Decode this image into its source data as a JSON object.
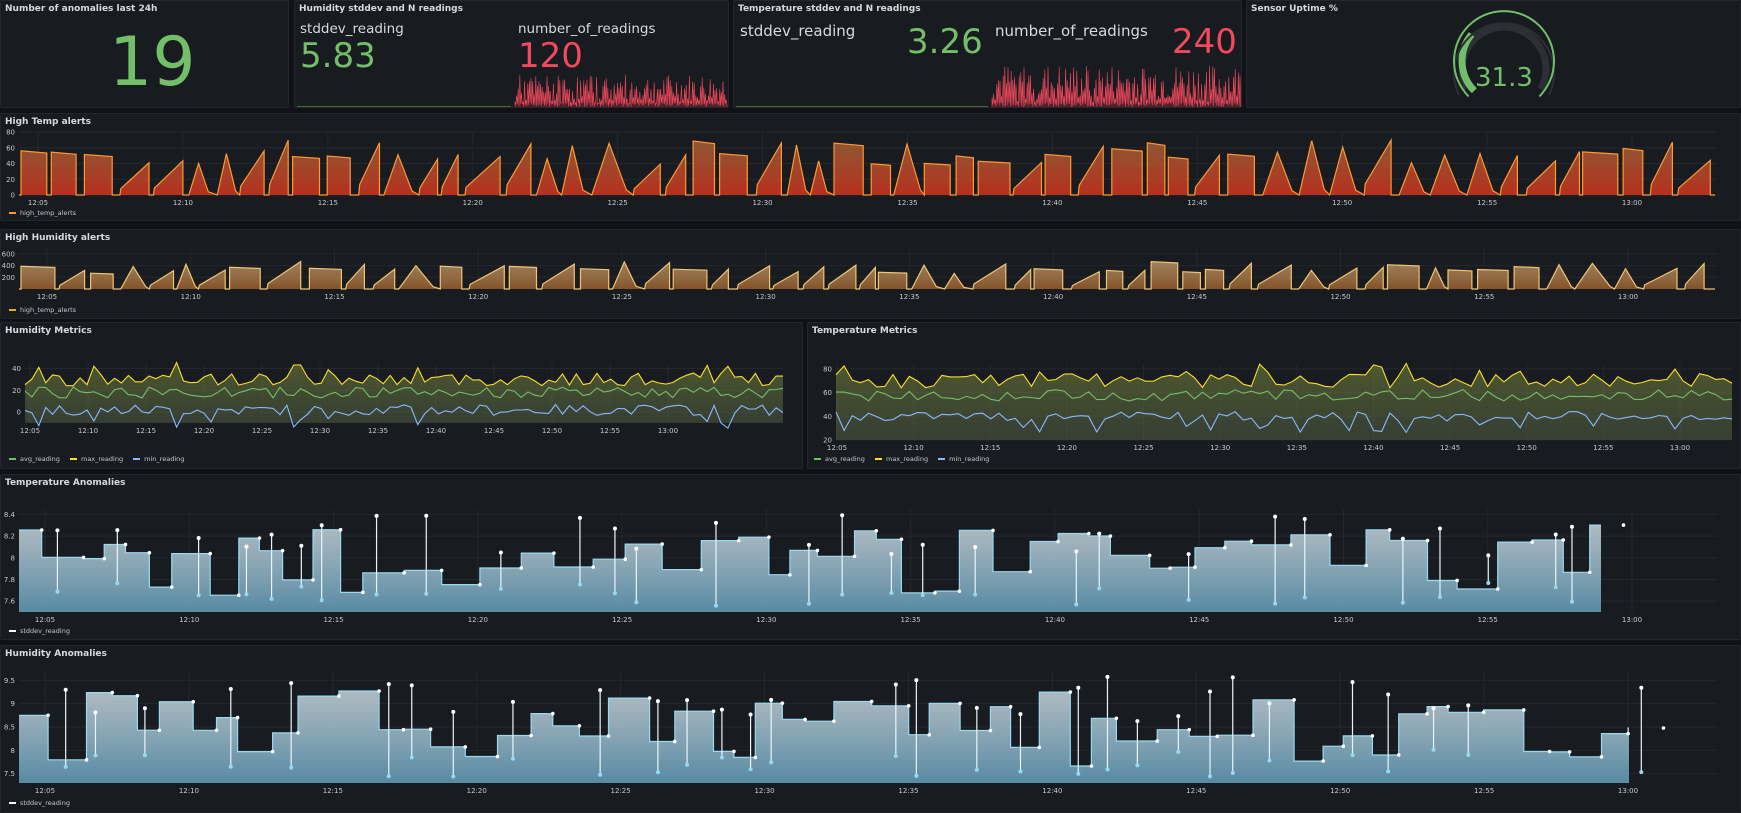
{
  "panels": {
    "anomalies": {
      "title": "Number of anomalies last 24h",
      "value": "19"
    },
    "humidity_stats": {
      "title": "Humidity stddev and N readings",
      "stddev_label": "stddev_reading",
      "stddev_value": "5.83",
      "count_label": "number_of_readings",
      "count_value": "120"
    },
    "temp_stats": {
      "title": "Temperature stddev and N readings",
      "stddev_label": "stddev_reading",
      "stddev_value": "3.26",
      "count_label": "number_of_readings",
      "count_value": "240"
    },
    "uptime": {
      "title": "Sensor Uptime %",
      "value": "31.3",
      "gauge_fraction": 0.313
    },
    "high_temp": {
      "title": "High Temp alerts",
      "legend": "high_temp_alerts"
    },
    "high_humidity": {
      "title": "High Humidity alerts",
      "legend": "high_temp_alerts"
    },
    "humidity_metrics": {
      "title": "Humidity Metrics",
      "legend": [
        "avg_reading",
        "max_reading",
        "min_reading"
      ]
    },
    "temp_metrics": {
      "title": "Temperature Metrics",
      "legend": [
        "avg_reading",
        "max_reading",
        "min_reading"
      ]
    },
    "temp_anomalies": {
      "title": "Temperature Anomalies",
      "legend": "stddev_reading"
    },
    "humidity_anomalies": {
      "title": "Humidity Anomalies",
      "legend": "stddev_reading"
    }
  },
  "colors": {
    "green": "#73bf69",
    "red": "#f2495c",
    "orange": "#ff9830",
    "yellow": "#fade2a",
    "blue": "#8ab8ff",
    "cyan": "#96d9f0"
  },
  "chart_data": [
    {
      "id": "high_temp",
      "type": "area",
      "title": "High Temp alerts",
      "x": [
        "12:05",
        "12:10",
        "12:15",
        "12:20",
        "12:25",
        "12:30",
        "12:35",
        "12:40",
        "12:45",
        "12:50",
        "12:55",
        "13:00"
      ],
      "yticks": [
        0,
        20,
        40,
        60,
        80
      ],
      "ylim": [
        0,
        80
      ],
      "series": [
        {
          "name": "high_temp_alerts",
          "color": "#ff9830"
        }
      ]
    },
    {
      "id": "high_humidity",
      "type": "area",
      "title": "High Humidity alerts",
      "x": [
        "12:05",
        "12:10",
        "12:15",
        "12:20",
        "12:25",
        "12:30",
        "12:35",
        "12:40",
        "12:45",
        "12:50",
        "12:55",
        "13:00"
      ],
      "yticks": [
        200,
        400,
        600
      ],
      "ylim": [
        0,
        700
      ],
      "series": [
        {
          "name": "high_temp_alerts",
          "color": "#e0b400"
        }
      ]
    },
    {
      "id": "humidity_metrics",
      "type": "line",
      "title": "Humidity Metrics",
      "x": [
        "12:05",
        "12:10",
        "12:15",
        "12:20",
        "12:25",
        "12:30",
        "12:35",
        "12:40",
        "12:45",
        "12:50",
        "12:55",
        "13:00"
      ],
      "yticks": [
        0,
        20,
        40
      ],
      "ylim": [
        -10,
        45
      ],
      "series": [
        {
          "name": "avg_reading",
          "color": "#73bf69"
        },
        {
          "name": "max_reading",
          "color": "#fade2a"
        },
        {
          "name": "min_reading",
          "color": "#8ab8ff"
        }
      ]
    },
    {
      "id": "temp_metrics",
      "type": "line",
      "title": "Temperature Metrics",
      "x": [
        "12:05",
        "12:10",
        "12:15",
        "12:20",
        "12:25",
        "12:30",
        "12:35",
        "12:40",
        "12:45",
        "12:50",
        "12:55",
        "13:00"
      ],
      "yticks": [
        20,
        40,
        60,
        80
      ],
      "ylim": [
        20,
        85
      ],
      "series": [
        {
          "name": "avg_reading",
          "color": "#73bf69"
        },
        {
          "name": "max_reading",
          "color": "#fade2a"
        },
        {
          "name": "min_reading",
          "color": "#8ab8ff"
        }
      ]
    },
    {
      "id": "temp_anomalies",
      "type": "area",
      "title": "Temperature Anomalies",
      "x": [
        "12:05",
        "12:10",
        "12:15",
        "12:20",
        "12:25",
        "12:30",
        "12:35",
        "12:40",
        "12:45",
        "12:50",
        "12:55",
        "13:00"
      ],
      "yticks": [
        7.6,
        7.8,
        8,
        8.2,
        8.4
      ],
      "ylim": [
        7.5,
        8.45
      ],
      "series": [
        {
          "name": "stddev_reading",
          "color": "#96d9f0"
        }
      ]
    },
    {
      "id": "humidity_anomalies",
      "type": "area",
      "title": "Humidity Anomalies",
      "x": [
        "12:05",
        "12:10",
        "12:15",
        "12:20",
        "12:25",
        "12:30",
        "12:35",
        "12:40",
        "12:45",
        "12:50",
        "12:55",
        "13:00"
      ],
      "yticks": [
        7.5,
        8,
        8.5,
        9,
        9.5
      ],
      "ylim": [
        7.3,
        9.7
      ],
      "series": [
        {
          "name": "stddev_reading",
          "color": "#96d9f0"
        }
      ]
    }
  ]
}
